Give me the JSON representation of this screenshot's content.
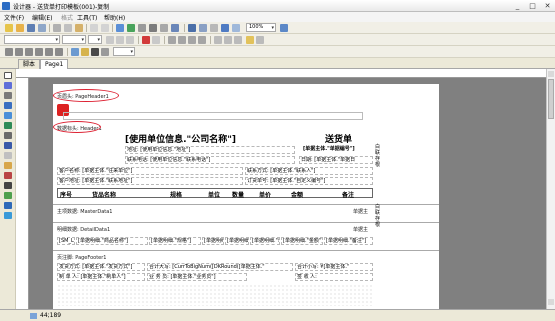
{
  "window": {
    "title": "设计器 - 送货单打印模板(001)-复制",
    "minimize": "_",
    "maximize": "□",
    "close": "✕"
  },
  "menu": [
    "文件(F)",
    "编辑(E)",
    "格式",
    "工具(T)",
    "帮助(H)"
  ],
  "toolbar2": {
    "zoom": "100%"
  },
  "tabs": [
    "脚本",
    "Page1"
  ],
  "bands": {
    "page_header": "页眉头: PageHeader1",
    "header": "数据标头: Header1",
    "master": "主项数据: MasterData1",
    "detail": "明细数据: DetailData1",
    "page_footer": "页注脚: PageFooter1"
  },
  "report": {
    "company_title": "[使用单位信息.\"公司名称\"]",
    "doc_title": "送货单",
    "doc_no": "[单据主体.\"单据编号\"]",
    "address": "地址: [使用单位信息.\"地址\"]",
    "phone": "联系电话: [使用单位信息.\"联系电话\"]",
    "date": "日期: [单据主体.\"单据日",
    "customer_name": "客户名称: [单据主体.\"往来单位\"]",
    "contact": "联系方式: [单据主体.\"联系人\"]",
    "customer_addr": "客户地址: [单据主体.\"联系地址\"]",
    "order_no": "订货单号: [单据主体.\"自定义编号\"]",
    "col_headers": [
      "序号",
      "货品名称",
      "规格",
      "单位",
      "数量",
      "单价",
      "金额",
      "备注"
    ],
    "detail_row": [
      "[SM_Lin",
      "[单据明细.\"商品名称\"]",
      "[单据明细.\"规格\"]",
      "[单据明细.\"单位",
      "[单据明细.\"数量",
      "[单据明细.\"单价",
      "[单据明细.\"金额\"]",
      "[单据明细.\"备注\"]"
    ],
    "master_right": "单据主",
    "detail_right": "单据主",
    "footer_send": "发货方式: [单据主体.\"发货方式\"]",
    "footer_total_cn": "合计大写: [CurrToBigNum([DKRound([单据主体.\"",
    "footer_total": "合计小写: ¥[单据主体.\"",
    "footer_maker": "制 单 人: [单据主体.\"制单人\"]",
    "footer_sales": "业 务 员: [单据主体.\"业务员\"]",
    "footer_sign": "签 收 人:",
    "side_note_1": "白联存根",
    "side_note_2": "白联存根"
  },
  "status": {
    "coords": "44;189"
  }
}
